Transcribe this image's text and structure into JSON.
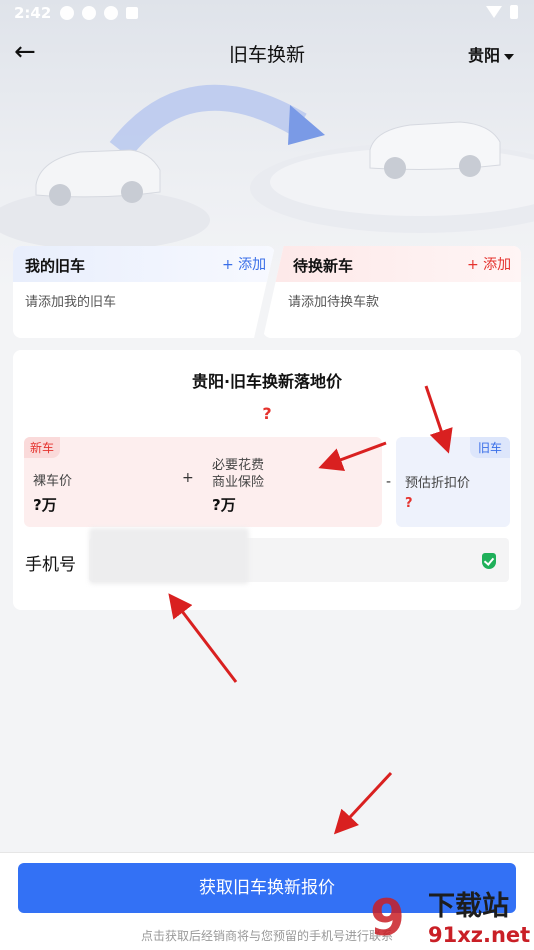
{
  "status_bar": {
    "time": "2:42"
  },
  "nav": {
    "title": "旧车换新",
    "city": "贵阳"
  },
  "cards": {
    "old": {
      "title": "我的旧车",
      "add": "+ 添加",
      "hint": "请添加我的旧车"
    },
    "new": {
      "title": "待换新车",
      "add": "+ 添加",
      "hint": "请添加待换车款"
    }
  },
  "price": {
    "title": "贵阳·旧车换新落地价",
    "value": "?",
    "new_tag": "新车",
    "old_tag": "旧车",
    "bare_label": "裸车价",
    "bare_value": "?万",
    "plus": "+",
    "fees_label_1": "必要花费",
    "fees_label_2": "商业保险",
    "fees_value": "?万",
    "minus": "-",
    "discount_label": "预估折扣价",
    "discount_value": "?"
  },
  "phone": {
    "label": "手机号",
    "value": ""
  },
  "cta": {
    "label": "获取旧车换新报价",
    "note": "点击获取后经销商将与您预留的手机号进行联系"
  },
  "watermark": {
    "text_cn": "下载站",
    "text_url": "91xz.net"
  },
  "colors": {
    "primary": "#3371f5",
    "accent_red": "#e5322d",
    "annotation_arrow": "#d92020"
  },
  "icons": [
    "back-arrow-icon",
    "chevron-down-icon",
    "shield-check-icon",
    "car-illustration"
  ]
}
